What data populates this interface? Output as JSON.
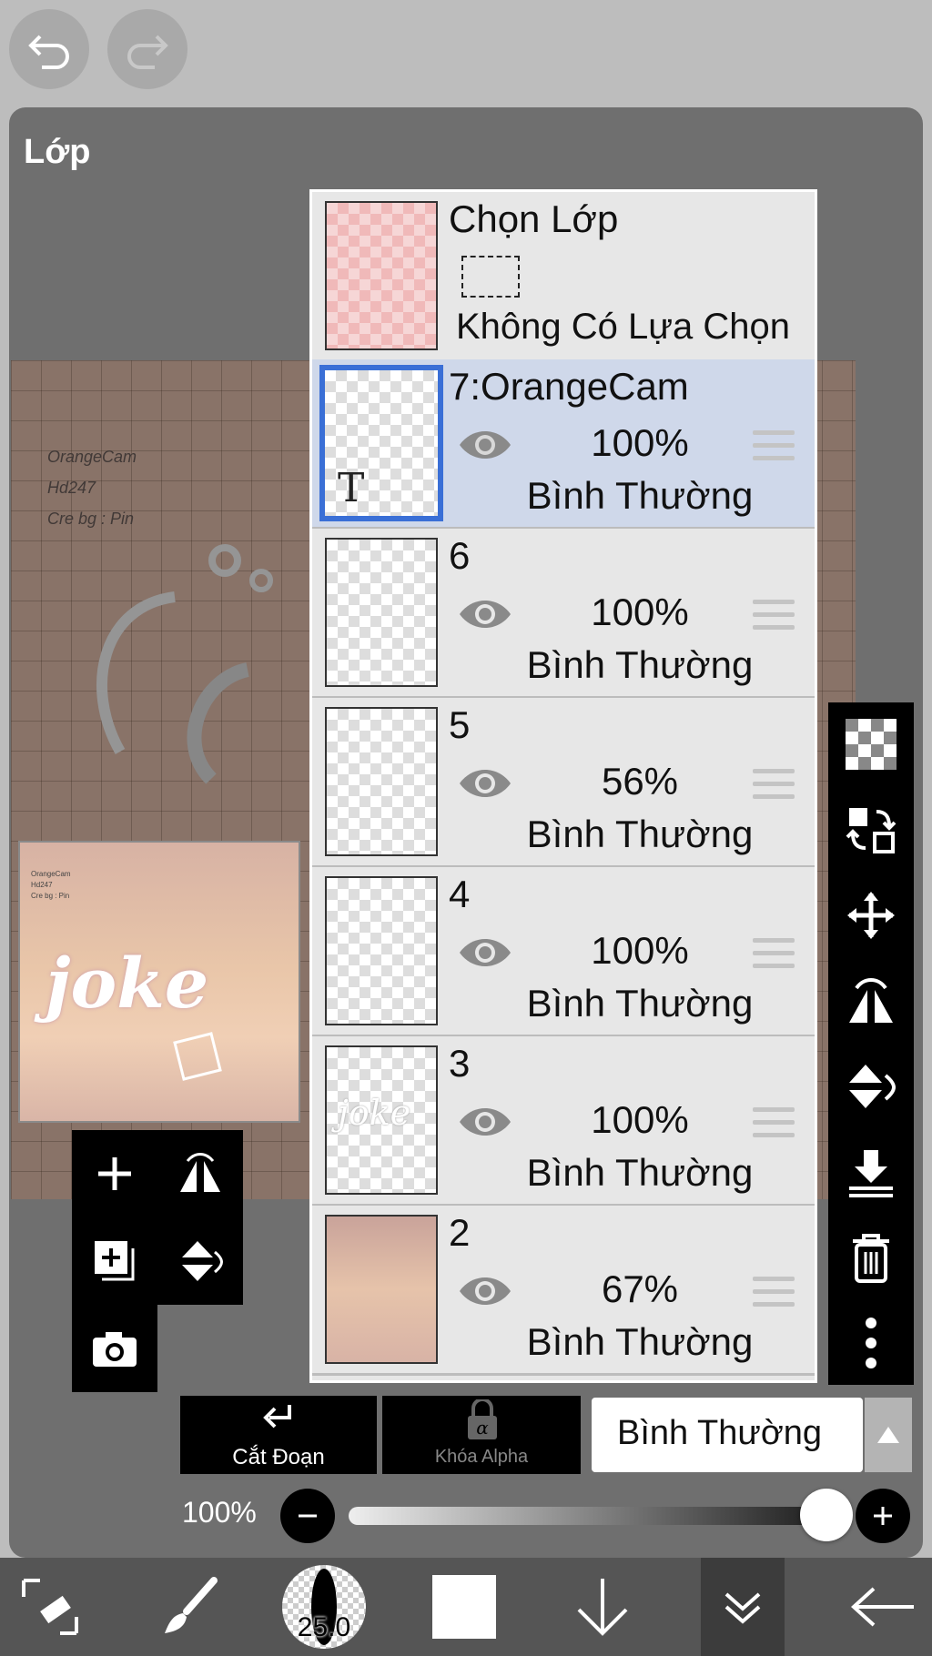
{
  "panel": {
    "title": "Lớp"
  },
  "canvas": {
    "credit_lines": [
      "OrangeCam",
      "Hd247",
      "Cre bg : Pin"
    ],
    "artwork_text": "joke"
  },
  "selection_layer": {
    "title": "Chọn Lớp",
    "subtitle": "Không Có Lựa Chọn"
  },
  "layers": [
    {
      "name": "7:OrangeCam",
      "opacity": "100%",
      "mode": "Bình Thường",
      "selected": true,
      "text_layer_glyph": "T"
    },
    {
      "name": "6",
      "opacity": "100%",
      "mode": "Bình Thường",
      "selected": false
    },
    {
      "name": "5",
      "opacity": "56%",
      "mode": "Bình Thường",
      "selected": false
    },
    {
      "name": "4",
      "opacity": "100%",
      "mode": "Bình Thường",
      "selected": false
    },
    {
      "name": "3",
      "opacity": "100%",
      "mode": "Bình Thường",
      "selected": false,
      "thumb_text": "joke"
    },
    {
      "name": "2",
      "opacity": "67%",
      "mode": "Bình Thường",
      "selected": false
    }
  ],
  "controls": {
    "clip_label": "Cắt Đoạn",
    "alpha_lock_label": "Khóa Alpha",
    "blend_mode": "Bình Thường",
    "opacity_label": "100%",
    "opacity_value": 1.0
  },
  "bottom_bar": {
    "brush_size": "25.0"
  },
  "colors": {
    "selected_row": "#cfd8ea",
    "selected_border": "#3a6fd6",
    "panel": "#6f6f6f"
  }
}
